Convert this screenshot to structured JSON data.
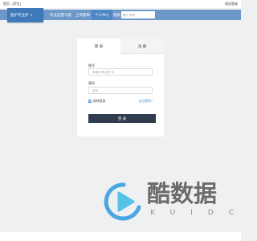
{
  "window": {
    "title": "首页 - [学生]",
    "logout_label": "退出登录"
  },
  "nav": {
    "brand_label": "医护专业护",
    "brand_chevron": "▾",
    "items": [
      {
        "label": "作业运营习题",
        "active": false
      },
      {
        "label": "上传题目",
        "active": false
      },
      {
        "label": "个人中心",
        "active": true
      }
    ],
    "search_label": "搜索",
    "search_placeholder": "输入内容"
  },
  "login": {
    "tab_login": "登 录",
    "tab_register": "注 册",
    "account_label": "账号",
    "account_placeholder": "邮箱/手机/用户名",
    "password_label": "密码",
    "password_placeholder": "密码",
    "remember_label": "保持登录",
    "remember_checked": true,
    "forgot_label": "忘记密码?",
    "submit_label": "登 录"
  },
  "watermark": {
    "text": "酷数据",
    "subtext": "KUIDC",
    "play_color": "#56c2e8",
    "ring_color": "#4aa7df"
  },
  "colors": {
    "navbar": "#6e98c9",
    "brand": "#3f79b9",
    "active_tab": "#4f87c4",
    "login_button": "#2f3d4e",
    "link": "#3b86c9"
  }
}
